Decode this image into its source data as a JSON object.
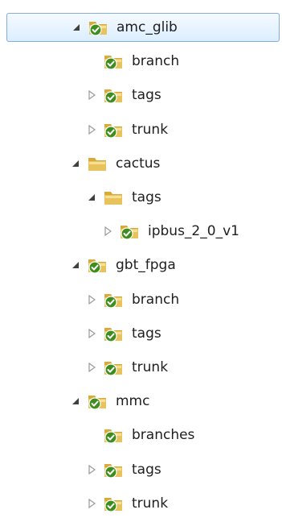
{
  "tree": {
    "nodes": [
      {
        "id": "amc_glib",
        "label": "amc_glib",
        "depth": 0,
        "expander": "expanded",
        "icon": "svn-folder-check-icon",
        "selected": true
      },
      {
        "id": "amc_glib-branch",
        "label": "branch",
        "depth": 1,
        "expander": "none",
        "icon": "svn-folder-check-icon"
      },
      {
        "id": "amc_glib-tags",
        "label": "tags",
        "depth": 1,
        "expander": "collapsed",
        "icon": "svn-folder-check-icon"
      },
      {
        "id": "amc_glib-trunk",
        "label": "trunk",
        "depth": 1,
        "expander": "collapsed",
        "icon": "svn-folder-check-icon"
      },
      {
        "id": "cactus",
        "label": "cactus",
        "depth": 0,
        "expander": "expanded",
        "icon": "folder-icon"
      },
      {
        "id": "cactus-tags",
        "label": "tags",
        "depth": 1,
        "expander": "expanded",
        "icon": "folder-icon"
      },
      {
        "id": "cactus-tags-ipbus",
        "label": "ipbus_2_0_v1",
        "depth": 2,
        "expander": "collapsed",
        "icon": "svn-folder-check-icon"
      },
      {
        "id": "gbt_fpga",
        "label": "gbt_fpga",
        "depth": 0,
        "expander": "expanded",
        "icon": "svn-folder-check-icon"
      },
      {
        "id": "gbt_fpga-branch",
        "label": "branch",
        "depth": 1,
        "expander": "collapsed",
        "icon": "svn-folder-check-icon"
      },
      {
        "id": "gbt_fpga-tags",
        "label": "tags",
        "depth": 1,
        "expander": "collapsed",
        "icon": "svn-folder-check-icon"
      },
      {
        "id": "gbt_fpga-trunk",
        "label": "trunk",
        "depth": 1,
        "expander": "collapsed",
        "icon": "svn-folder-check-icon"
      },
      {
        "id": "mmc",
        "label": "mmc",
        "depth": 0,
        "expander": "expanded",
        "icon": "svn-folder-check-icon"
      },
      {
        "id": "mmc-branches",
        "label": "branches",
        "depth": 1,
        "expander": "none",
        "icon": "svn-folder-check-icon"
      },
      {
        "id": "mmc-tags",
        "label": "tags",
        "depth": 1,
        "expander": "collapsed",
        "icon": "svn-folder-check-icon"
      },
      {
        "id": "mmc-trunk",
        "label": "trunk",
        "depth": 1,
        "expander": "collapsed",
        "icon": "svn-folder-check-icon"
      }
    ]
  },
  "colors": {
    "selection_border": "#84acdd",
    "folder_yellow": "#e8c25a",
    "check_green": "#3d8d1f",
    "expander_dark": "#404040",
    "expander_light": "#9a9a9a"
  }
}
